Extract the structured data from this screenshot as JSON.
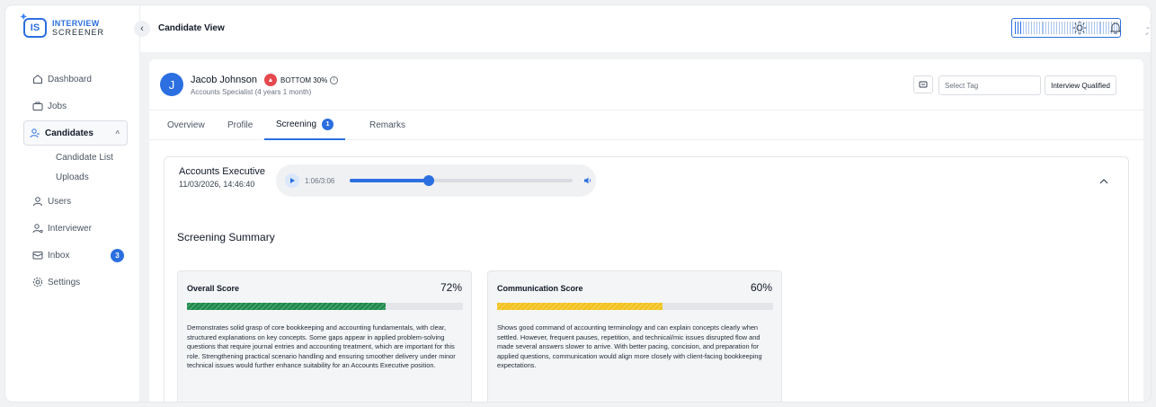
{
  "app": {
    "logo_badge": "IS",
    "logo_line1": "INTERVIEW",
    "logo_line2": "SCREENER"
  },
  "sidebar": {
    "items": [
      {
        "label": "Dashboard",
        "icon": "home-icon"
      },
      {
        "label": "Jobs",
        "icon": "briefcase-icon"
      },
      {
        "label": "Candidates",
        "icon": "people-icon",
        "active": true
      },
      {
        "label": "Candidate List"
      },
      {
        "label": "Uploads"
      },
      {
        "label": "Users",
        "icon": "user-icon"
      },
      {
        "label": "Interviewer",
        "icon": "interviewer-icon"
      },
      {
        "label": "Inbox",
        "icon": "mail-icon",
        "badge": "3"
      },
      {
        "label": "Settings",
        "icon": "gear-icon"
      }
    ]
  },
  "topbar": {
    "page_title": "Candidate View",
    "meter_level": 0.08,
    "spinner_count": "0"
  },
  "candidate": {
    "avatar_initial": "J",
    "name": "Jacob Johnson",
    "role": "Accounts Specialist (4 years 1 month)",
    "rank_label": "BOTTOM 30%"
  },
  "actions": {
    "tag_placeholder": "Select Tag",
    "qualify_label": "Interview Qualified"
  },
  "tabs": [
    {
      "label": "Overview"
    },
    {
      "label": "Profile"
    },
    {
      "label": "Screening",
      "badge": "1",
      "active": true
    },
    {
      "label": "Remarks"
    }
  ],
  "screening": {
    "job_title": "Accounts Executive",
    "date": "11/03/2026, 14:46:40",
    "player_time": "1:06/3:06",
    "progress": 0.355,
    "summary_title": "Screening Summary",
    "scores": [
      {
        "label": "Overall Score",
        "value": "72%",
        "fraction": 0.72,
        "color": "#1f8a4c",
        "text": "Demonstrates solid grasp of core bookkeeping and accounting fundamentals, with clear, structured explanations on key concepts. Some gaps appear in applied problem-solving questions that require journal entries and accounting treatment, which are important for this role. Strengthening practical scenario handling and ensuring smoother delivery under minor technical issues would further enhance suitability for an Accounts Executive position."
      },
      {
        "label": "Communication Score",
        "value": "60%",
        "fraction": 0.6,
        "color": "#f3c21f",
        "text": "Shows good command of accounting terminology and can explain concepts clearly when settled. However, frequent pauses, repetition, and technical/mic issues disrupted flow and made several answers slower to arrive. With better pacing, concision, and preparation for applied questions, communication would align more closely with client-facing bookkeeping expectations."
      }
    ]
  }
}
